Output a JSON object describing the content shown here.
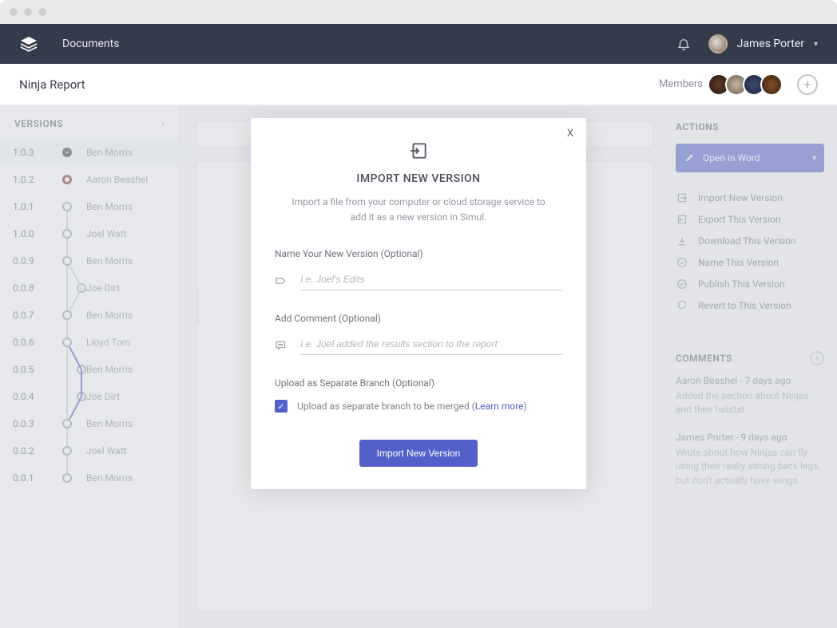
{
  "nav": {
    "documents": "Documents",
    "user_name": "James Porter"
  },
  "subheader": {
    "title": "Ninja Report",
    "members_label": "Members"
  },
  "sidebar": {
    "title": "VERSIONS",
    "versions": [
      {
        "num": "1.0.3",
        "author": "Ben Morris"
      },
      {
        "num": "1.0.2",
        "author": "Aaron Beashel"
      },
      {
        "num": "1.0.1",
        "author": "Ben Morris"
      },
      {
        "num": "1.0.0",
        "author": "Joel Watt"
      },
      {
        "num": "0.0.9",
        "author": "Ben Morris"
      },
      {
        "num": "0.0.8",
        "author": "Joe Dirt"
      },
      {
        "num": "0.0.7",
        "author": "Ben Morris"
      },
      {
        "num": "0.0.6",
        "author": "Lloyd Tom"
      },
      {
        "num": "0.0.5",
        "author": "Ben Morris"
      },
      {
        "num": "0.0.4",
        "author": "Joe Dirt"
      },
      {
        "num": "0.0.3",
        "author": "Ben Morris"
      },
      {
        "num": "0.0.2",
        "author": "Joel Watt"
      },
      {
        "num": "0.0.1",
        "author": "Ben Morris"
      }
    ]
  },
  "actions": {
    "title": "ACTIONS",
    "primary": "Open in Word",
    "items": [
      "Import New Version",
      "Export This Version",
      "Download This Version",
      "Name This Version",
      "Publish This Version",
      "Revert to This Version"
    ]
  },
  "comments": {
    "title": "COMMENTS",
    "list": [
      {
        "meta": "Aaron Beashel - 7 days ago",
        "body": "Added the section about Ninjas and their habitat"
      },
      {
        "meta": "James Porter - 9 days ago",
        "body": "Wrote about how Ninjas can fly using their really strong back legs, but don't actually have wings."
      }
    ]
  },
  "modal": {
    "title": "IMPORT NEW VERSION",
    "subtitle": "Import a file from your computer or cloud storage service to add it as a new version in Simul.",
    "name_label": "Name Your New Version (Optional)",
    "name_placeholder": "I.e. Joel's Edits",
    "comment_label": "Add Comment (Optional)",
    "comment_placeholder": "I.e. Joel added the results section to the report",
    "branch_label": "Upload as Separate Branch (Optional)",
    "branch_check_text": "Upload as separate branch to be merged (",
    "learn_more": "Learn more",
    "branch_check_close": ")",
    "submit": "Import New Version",
    "close": "X"
  }
}
